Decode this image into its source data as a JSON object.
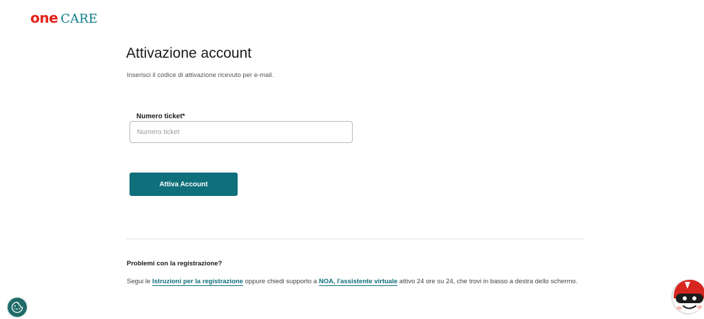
{
  "brand": {
    "one": "one",
    "care": "CARE"
  },
  "page": {
    "title": "Attivazione account",
    "subtitle": "Inserisci il codice di attivazione ricevuto per e-mail."
  },
  "form": {
    "ticket_label": "Numero ticket*",
    "ticket_placeholder": "Numero ticket",
    "ticket_value": "",
    "submit_label": "Attiva Account"
  },
  "help": {
    "heading": "Problemi con la registrazione?",
    "text_1": "Segui le ",
    "link_1": "Istruzioni per la registrazione",
    "text_2": " oppure chiedi supporto a ",
    "link_2": "NOA, l'assistente virtuale",
    "text_3": " attivo 24 ore su 24, che trovi in basso a destra dello schermo."
  },
  "widgets": {
    "cookie_icon": "cookie-icon",
    "assistant_icon": "noa-assistant-avatar-icon"
  },
  "colors": {
    "brand_red": "#e2231a",
    "brand_teal": "#0f7c8c",
    "button_teal": "#0f6f7a",
    "cookie_green": "#1f6b69"
  }
}
